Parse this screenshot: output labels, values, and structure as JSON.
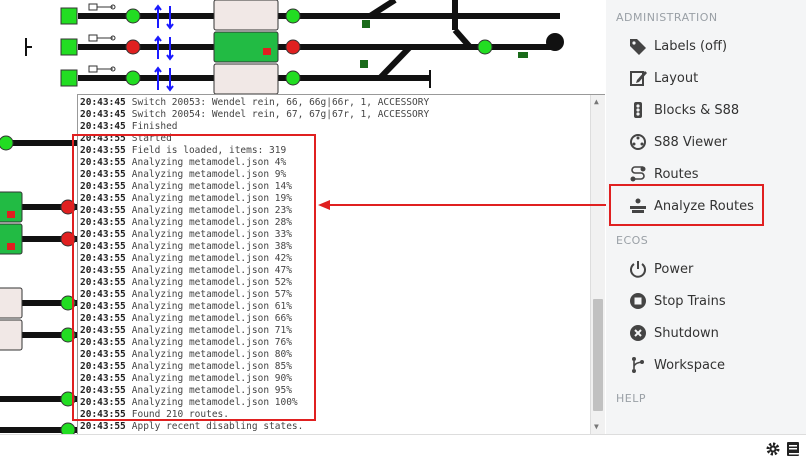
{
  "sidebar": {
    "section_admin": "ADMINISTRATION",
    "section_ecos": "ECOS",
    "section_help": "HELP",
    "admin_items": [
      {
        "label": "Labels (off)",
        "icon": "tag-icon"
      },
      {
        "label": "Layout",
        "icon": "edit-icon"
      },
      {
        "label": "Blocks & S88",
        "icon": "traffic-light-icon"
      },
      {
        "label": "S88 Viewer",
        "icon": "sensor-icon"
      },
      {
        "label": "Routes",
        "icon": "route-icon"
      },
      {
        "label": "Analyze Routes",
        "icon": "analyze-icon"
      }
    ],
    "ecos_items": [
      {
        "label": "Power",
        "icon": "power-icon"
      },
      {
        "label": "Stop Trains",
        "icon": "stop-icon"
      },
      {
        "label": "Shutdown",
        "icon": "shutdown-icon"
      },
      {
        "label": "Workspace",
        "icon": "workspace-icon"
      }
    ]
  },
  "log": {
    "lines": [
      {
        "time": "20:43:45",
        "msg": "Switch 20053: Wendel rein, 66, 66g|66r, 1, ACCESSORY"
      },
      {
        "time": "20:43:45",
        "msg": "Switch 20054: Wendel rein, 67, 67g|67r, 1, ACCESSORY"
      },
      {
        "time": "20:43:45",
        "msg": "Finished"
      },
      {
        "time": "20:43:55",
        "msg": "Started"
      },
      {
        "time": "20:43:55",
        "msg": "Field is loaded, items: 319"
      },
      {
        "time": "20:43:55",
        "msg": "Analyzing metamodel.json 4%"
      },
      {
        "time": "20:43:55",
        "msg": "Analyzing metamodel.json 9%"
      },
      {
        "time": "20:43:55",
        "msg": "Analyzing metamodel.json 14%"
      },
      {
        "time": "20:43:55",
        "msg": "Analyzing metamodel.json 19%"
      },
      {
        "time": "20:43:55",
        "msg": "Analyzing metamodel.json 23%"
      },
      {
        "time": "20:43:55",
        "msg": "Analyzing metamodel.json 28%"
      },
      {
        "time": "20:43:55",
        "msg": "Analyzing metamodel.json 33%"
      },
      {
        "time": "20:43:55",
        "msg": "Analyzing metamodel.json 38%"
      },
      {
        "time": "20:43:55",
        "msg": "Analyzing metamodel.json 42%"
      },
      {
        "time": "20:43:55",
        "msg": "Analyzing metamodel.json 47%"
      },
      {
        "time": "20:43:55",
        "msg": "Analyzing metamodel.json 52%"
      },
      {
        "time": "20:43:55",
        "msg": "Analyzing metamodel.json 57%"
      },
      {
        "time": "20:43:55",
        "msg": "Analyzing metamodel.json 61%"
      },
      {
        "time": "20:43:55",
        "msg": "Analyzing metamodel.json 66%"
      },
      {
        "time": "20:43:55",
        "msg": "Analyzing metamodel.json 71%"
      },
      {
        "time": "20:43:55",
        "msg": "Analyzing metamodel.json 76%"
      },
      {
        "time": "20:43:55",
        "msg": "Analyzing metamodel.json 80%"
      },
      {
        "time": "20:43:55",
        "msg": "Analyzing metamodel.json 85%"
      },
      {
        "time": "20:43:55",
        "msg": "Analyzing metamodel.json 90%"
      },
      {
        "time": "20:43:55",
        "msg": "Analyzing metamodel.json 95%"
      },
      {
        "time": "20:43:55",
        "msg": "Analyzing metamodel.json 100%"
      },
      {
        "time": "20:43:55",
        "msg": "Found 210 routes."
      },
      {
        "time": "20:43:55",
        "msg": "Apply recent disabling states."
      }
    ]
  },
  "statusbar": {
    "settings_icon": "gear-icon",
    "book_icon": "book-icon"
  },
  "colors": {
    "highlight": "#e02020",
    "signal_green": "#22dd22",
    "signal_red": "#e02020",
    "track": "#111111",
    "block_green": "#22bb44"
  }
}
